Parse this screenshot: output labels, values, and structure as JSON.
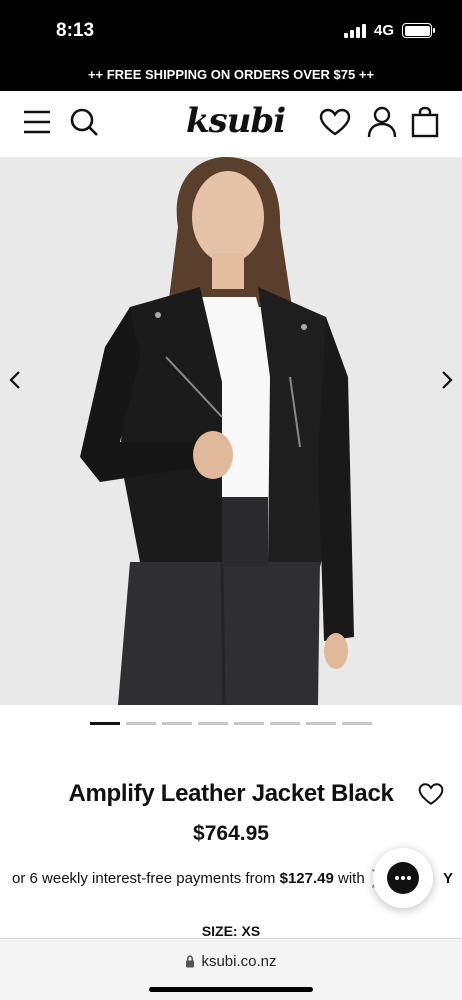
{
  "status_bar": {
    "time": "8:13",
    "network": "4G",
    "battery_level": 1.0
  },
  "promo": {
    "text": "++ FREE SHIPPING ON ORDERS OVER $75 ++"
  },
  "header": {
    "logo": "ksubi",
    "icons": [
      "menu-icon",
      "search-icon",
      "heart-icon",
      "user-icon",
      "bag-icon"
    ]
  },
  "carousel": {
    "slide_count": 8,
    "active_index": 0
  },
  "product": {
    "title": "Amplify Leather Jacket Black",
    "price": "$764.95",
    "installment_prefix": "or 6 weekly interest-free payments from",
    "installment_amount": "$127.49",
    "installment_with": "with",
    "installment_brand_mark": "Y",
    "size_label": "SIZE: XS"
  },
  "browser": {
    "url": "ksubi.co.nz"
  },
  "colors": {
    "promo_bg": "#000000",
    "laybuy_accent": "#786DFF",
    "hero_bg": "#e9e9e9"
  }
}
